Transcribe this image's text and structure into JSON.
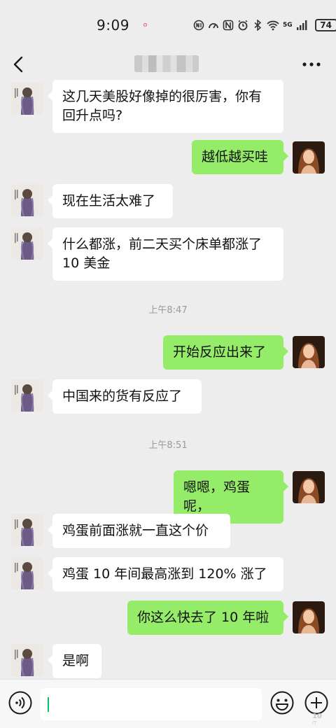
{
  "status_bar": {
    "time": "9:09",
    "network": "5G",
    "battery": "74",
    "icons": [
      "nfc-icon",
      "hd-call-icon",
      "nfc-n-icon",
      "alarm-icon",
      "bluetooth-icon",
      "wifi-icon",
      "signal-icon",
      "battery-icon"
    ]
  },
  "nav": {
    "back_icon": "chevron-left-icon",
    "title_obscured": true,
    "more_icon": "more-dots-icon"
  },
  "colors": {
    "background": "#ededed",
    "outgoing_bubble": "#95ec69",
    "incoming_bubble": "#ffffff",
    "timestamp_text": "#9a9a9a",
    "caret": "#07c160"
  },
  "messages": [
    {
      "side": "in",
      "text": "这几天美股好像掉的很厉害，你有\n回升点吗?"
    },
    {
      "side": "out",
      "text": "越低越买哇"
    },
    {
      "side": "in",
      "text": "现在生活太难了"
    },
    {
      "side": "in",
      "text": "什么都涨，前二天买个床单都涨了\n10 美金"
    },
    {
      "type": "time",
      "text": "上午8:47"
    },
    {
      "side": "out",
      "text": "开始反应出来了"
    },
    {
      "side": "in",
      "text": "中国来的货有反应了"
    },
    {
      "type": "time",
      "text": "上午8:51"
    },
    {
      "side": "out",
      "text": "嗯嗯，鸡蛋呢，"
    },
    {
      "side": "in",
      "text": "鸡蛋前面涨就一直这个价"
    },
    {
      "side": "in",
      "text": "鸡蛋 10 年间最高涨到 120% 涨了"
    },
    {
      "side": "out",
      "text": "你这么快去了 10 年啦"
    },
    {
      "side": "in",
      "text": "是啊"
    }
  ],
  "input_bar": {
    "voice_icon": "voice-icon",
    "emoji_icon": "emoji-icon",
    "plus_icon": "plus-circle-icon",
    "input_value": ""
  }
}
